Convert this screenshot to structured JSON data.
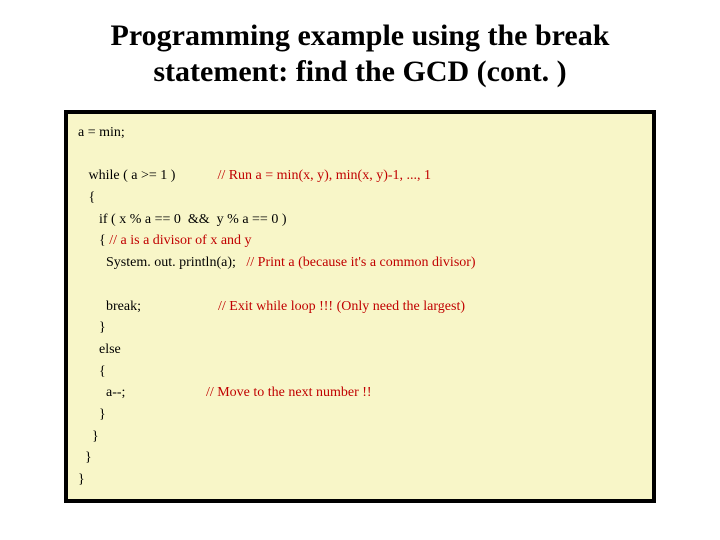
{
  "title_line1": "Programming example using the break",
  "title_line2": "statement: find the GCD (cont. )",
  "code": {
    "l1": "a = min;",
    "blank1": "",
    "l2a": "   while ( a >= 1 )            ",
    "l2c": "// Run a = min(x, y), min(x, y)-1, ..., 1",
    "l3": "   {",
    "l4": "      if ( x % a == 0  &&  y % a == 0 )",
    "l5a": "      { ",
    "l5c": "// a is a divisor of x and y",
    "l6a": "        System. out. println(a);   ",
    "l6c": "// Print a (because it's a common divisor)",
    "blank2": "",
    "l7a": "        break;                      ",
    "l7c": "// Exit while loop !!! (Only need the largest)",
    "l8": "      }",
    "l9": "      else",
    "l10": "      {",
    "l11a": "        a--;                       ",
    "l11c": "// Move to the next number !!",
    "l12": "      }",
    "l13": "    }",
    "l14": "  }",
    "l15": "}"
  }
}
